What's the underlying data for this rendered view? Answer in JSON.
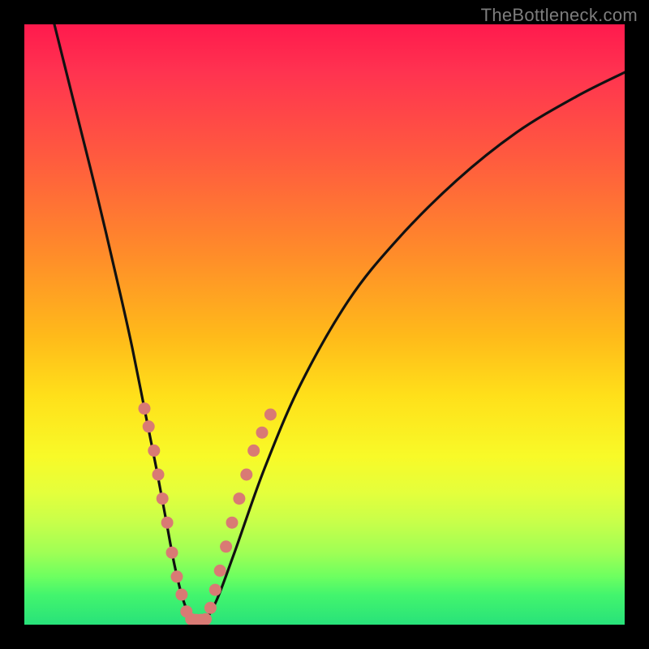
{
  "watermark": "TheBottleneck.com",
  "chart_data": {
    "type": "line",
    "title": "",
    "xlabel": "",
    "ylabel": "",
    "xlim": [
      0,
      100
    ],
    "ylim": [
      0,
      100
    ],
    "series": [
      {
        "name": "bottleneck-curve",
        "x": [
          5,
          8,
          12,
          16,
          18,
          20,
          22,
          23.5,
          25,
          26.5,
          28,
          30,
          32,
          35,
          40,
          46,
          54,
          62,
          72,
          82,
          92,
          100
        ],
        "y": [
          100,
          88,
          72,
          55,
          46,
          36,
          26,
          18,
          10,
          4,
          0.8,
          0.8,
          4,
          12,
          26,
          40,
          54,
          64,
          74,
          82,
          88,
          92
        ]
      }
    ],
    "markers": {
      "left_branch": [
        {
          "x": 20,
          "y": 36
        },
        {
          "x": 20.7,
          "y": 33
        },
        {
          "x": 21.6,
          "y": 29
        },
        {
          "x": 22.3,
          "y": 25
        },
        {
          "x": 23,
          "y": 21
        },
        {
          "x": 23.8,
          "y": 17
        },
        {
          "x": 24.6,
          "y": 12
        },
        {
          "x": 25.4,
          "y": 8
        },
        {
          "x": 26.2,
          "y": 5
        },
        {
          "x": 27,
          "y": 2.2
        }
      ],
      "valley": [
        {
          "x": 27.8,
          "y": 0.9
        },
        {
          "x": 28.6,
          "y": 0.8
        },
        {
          "x": 29.4,
          "y": 0.8
        },
        {
          "x": 30.2,
          "y": 0.9
        }
      ],
      "right_branch": [
        {
          "x": 31,
          "y": 2.8
        },
        {
          "x": 31.8,
          "y": 5.8
        },
        {
          "x": 32.6,
          "y": 9
        },
        {
          "x": 33.6,
          "y": 13
        },
        {
          "x": 34.6,
          "y": 17
        },
        {
          "x": 35.8,
          "y": 21
        },
        {
          "x": 37,
          "y": 25
        },
        {
          "x": 38.2,
          "y": 29
        },
        {
          "x": 39.6,
          "y": 32
        },
        {
          "x": 41,
          "y": 35
        }
      ]
    },
    "marker_color": "#d97a74",
    "curve_color": "#111111"
  }
}
